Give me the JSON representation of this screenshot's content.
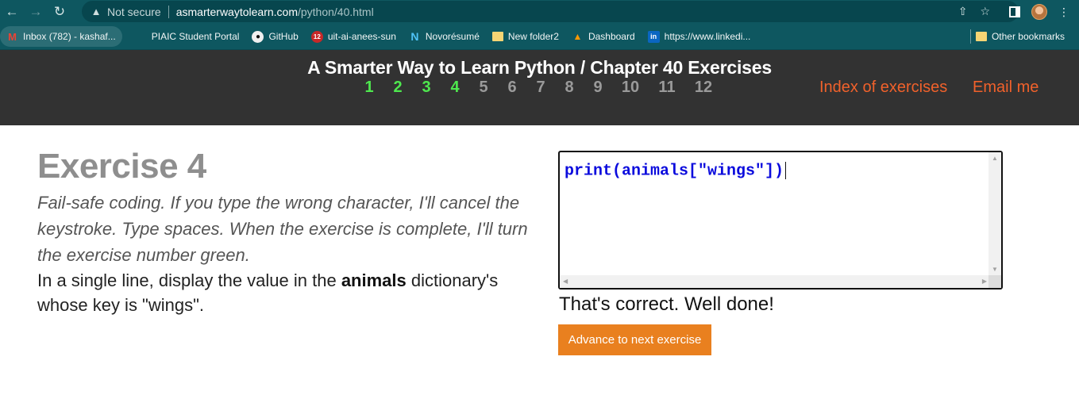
{
  "browser": {
    "security_label": "Not secure",
    "url_host": "asmarterwaytolearn.com",
    "url_path": "/python/40.html",
    "icons": [
      "back-icon",
      "forward-icon",
      "reload-icon",
      "warning-icon",
      "share-icon",
      "star-icon",
      "side-panel-icon",
      "avatar",
      "menu-icon"
    ]
  },
  "bookmarks": {
    "items": [
      {
        "label": "Inbox (782) - kashaf...",
        "icon": "gmail-icon"
      },
      {
        "label": "PIAIC Student Portal",
        "icon": "piaic-icon"
      },
      {
        "label": "GitHub",
        "icon": "github-icon"
      },
      {
        "label": "uit-ai-anees-sun",
        "icon": "twelve-icon"
      },
      {
        "label": "Novorésumé",
        "icon": "novoresume-icon"
      },
      {
        "label": "New folder2",
        "icon": "folder-icon"
      },
      {
        "label": "Dashboard",
        "icon": "dashboard-icon"
      },
      {
        "label": "https://www.linkedi...",
        "icon": "linkedin-icon"
      }
    ],
    "other": "Other bookmarks"
  },
  "header": {
    "title": "A Smarter Way to Learn Python / Chapter 40 Exercises",
    "chapters": [
      {
        "n": "1",
        "done": true
      },
      {
        "n": "2",
        "done": true
      },
      {
        "n": "3",
        "done": true
      },
      {
        "n": "4",
        "done": true
      },
      {
        "n": "5",
        "done": false
      },
      {
        "n": "6",
        "done": false
      },
      {
        "n": "7",
        "done": false
      },
      {
        "n": "8",
        "done": false
      },
      {
        "n": "9",
        "done": false
      },
      {
        "n": "10",
        "done": false
      },
      {
        "n": "11",
        "done": false
      },
      {
        "n": "12",
        "done": false
      }
    ],
    "index_link": "Index of exercises",
    "email_link": "Email me",
    "colors": {
      "done": "#4ee84e",
      "todo": "#9a9a9a",
      "link": "#f0612b"
    }
  },
  "exercise": {
    "title": "Exercise 4",
    "instructions": "Fail-safe coding. If you type the wrong character, I'll cancel the keystroke. Type spaces. When the exercise is complete, I'll turn the exercise number green.",
    "task_before": "In a single line, display the value in the ",
    "task_bold": "animals",
    "task_after": " dictionary's whose key is \"wings\"."
  },
  "editor": {
    "code": "print(animals[\"wings\"])"
  },
  "result": {
    "feedback": "That's correct. Well done!",
    "advance_label": "Advance to next exercise",
    "button_color": "#e9801f"
  }
}
